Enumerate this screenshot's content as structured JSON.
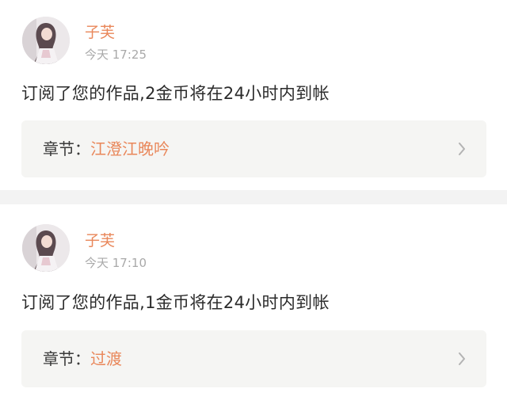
{
  "notifications": [
    {
      "username": "子芙",
      "time": "今天 17:25",
      "message": "订阅了您的作品,2金币将在24小时内到帐",
      "chapter_label": "章节：",
      "chapter_title": "江澄江晚吟"
    },
    {
      "username": "子芙",
      "time": "今天 17:10",
      "message": "订阅了您的作品,1金币将在24小时内到帐",
      "chapter_label": "章节：",
      "chapter_title": "过渡"
    }
  ],
  "colors": {
    "accent": "#e9875a",
    "chapter_bg": "#f5f5f3",
    "divider": "#f3f3f3",
    "time_gray": "#a9a9a9"
  },
  "icons": {
    "chevron": "chevron-right-icon",
    "avatar": "avatar"
  }
}
